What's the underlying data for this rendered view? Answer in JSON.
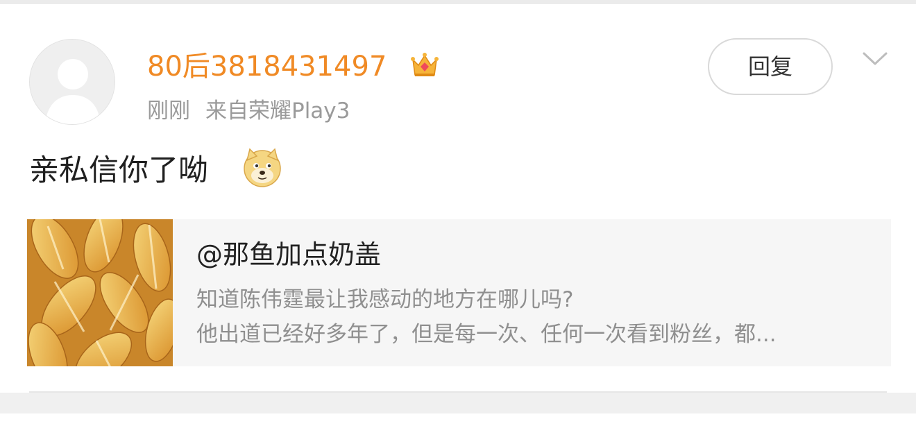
{
  "post": {
    "username": "80后3818431497",
    "badge_icon": "crown-icon",
    "time": "刚刚",
    "source": "来自荣耀Play3",
    "reply_label": "回复",
    "menu_icon": "chevron-down-icon",
    "comment_text": "亲私信你了呦",
    "emoji_icon": "doge-emoji-icon"
  },
  "quote": {
    "author": "@那鱼加点奶盖",
    "line1": "知道陈伟霆最让我感动的地方在哪儿吗?",
    "line2": "他出道已经好多年了，但是每一次、任何一次看到粉丝，都...",
    "thumbnail": "sunflower-seeds-image"
  },
  "colors": {
    "username": "#f08a25",
    "meta_text": "#9a9a9a",
    "quote_bg": "#f6f6f6"
  }
}
